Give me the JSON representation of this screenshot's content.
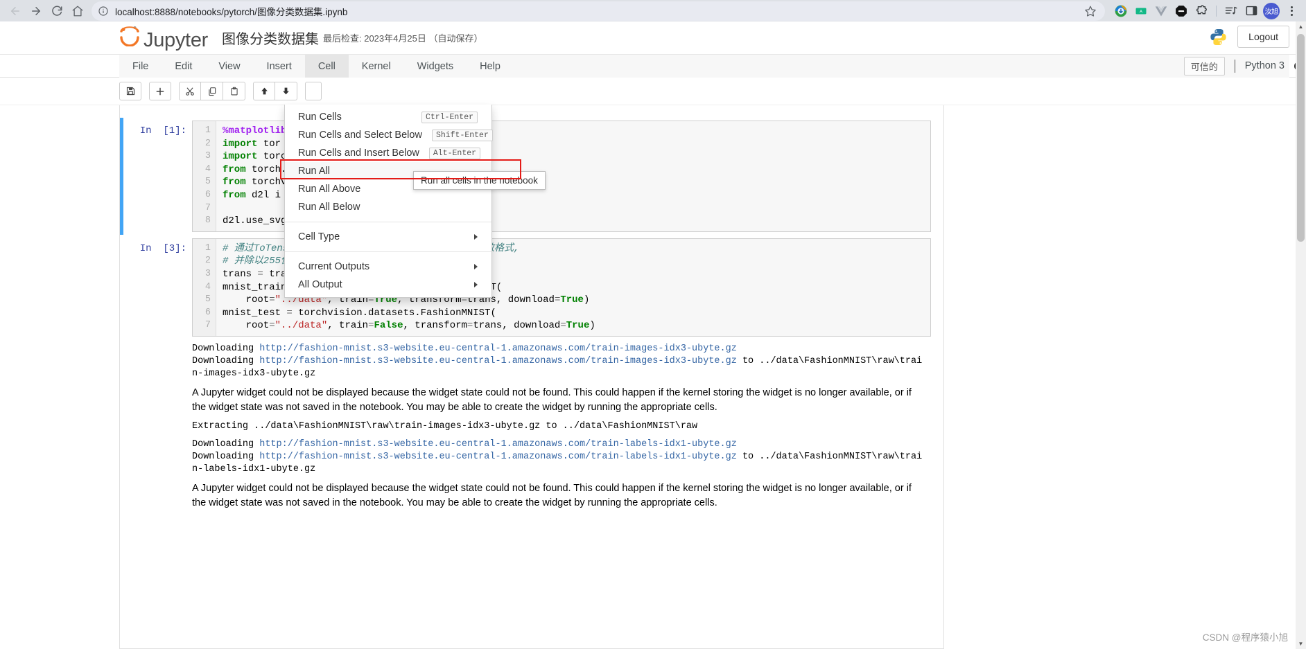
{
  "browser": {
    "url": "localhost:8888/notebooks/pytorch/图像分类数据集.ipynb",
    "nav": {
      "back": "back-arrow",
      "forward": "forward-arrow",
      "reload": "reload",
      "home": "home"
    },
    "info_icon": "info-circle-icon",
    "bookmark_icon": "star-icon",
    "extensions": [
      {
        "name": "idm-extension-icon",
        "glyph": "☁"
      },
      {
        "name": "translate-extension-icon",
        "glyph": "■"
      },
      {
        "name": "vue-devtools-icon",
        "glyph": "V"
      },
      {
        "name": "adblock-extension-icon",
        "glyph": "⊖"
      },
      {
        "name": "puzzle-extensions-icon",
        "glyph": "⬟"
      }
    ],
    "media_icon": "media-controls-icon",
    "sidepanel_icon": "side-panel-icon",
    "profile_initials": "汝旭",
    "menu_icon": "three-dot-menu-icon"
  },
  "jupyter": {
    "logo_text": "Jupyter",
    "notebook_title": "图像分类数据集",
    "checkpoint": "最后检查: 2023年4月25日 （自动保存）",
    "logout_label": "Logout",
    "python_logo": "python-logo",
    "menubar": [
      {
        "label": "File",
        "name": "menu-file",
        "active": false
      },
      {
        "label": "Edit",
        "name": "menu-edit",
        "active": false
      },
      {
        "label": "View",
        "name": "menu-view",
        "active": false
      },
      {
        "label": "Insert",
        "name": "menu-insert",
        "active": false
      },
      {
        "label": "Cell",
        "name": "menu-cell",
        "active": true
      },
      {
        "label": "Kernel",
        "name": "menu-kernel",
        "active": false
      },
      {
        "label": "Widgets",
        "name": "menu-widgets",
        "active": false
      },
      {
        "label": "Help",
        "name": "menu-help",
        "active": false
      }
    ],
    "trusted_badge": "可信的",
    "kernel_name": "Python 3",
    "kernel_status": "idle-circle"
  },
  "cell_menu": {
    "items": [
      {
        "label": "Run Cells",
        "shortcut": "Ctrl-Enter",
        "name": "menu-run-cells",
        "submenu": false,
        "highlight": false
      },
      {
        "label": "Run Cells and Select Below",
        "shortcut": "Shift-Enter",
        "name": "menu-run-cells-select-below",
        "submenu": false,
        "highlight": false
      },
      {
        "label": "Run Cells and Insert Below",
        "shortcut": "Alt-Enter",
        "name": "menu-run-cells-insert-below",
        "submenu": false,
        "highlight": false
      },
      {
        "label": "Run All",
        "shortcut": "",
        "name": "menu-run-all",
        "submenu": false,
        "highlight": true
      },
      {
        "label": "Run All Above",
        "shortcut": "",
        "name": "menu-run-all-above",
        "submenu": false,
        "highlight": false
      },
      {
        "label": "Run All Below",
        "shortcut": "",
        "name": "menu-run-all-below",
        "submenu": false,
        "highlight": false
      },
      {
        "separator": true
      },
      {
        "label": "Cell Type",
        "shortcut": "",
        "name": "menu-cell-type",
        "submenu": true,
        "highlight": false
      },
      {
        "separator": true
      },
      {
        "label": "Current Outputs",
        "shortcut": "",
        "name": "menu-current-outputs",
        "submenu": true,
        "highlight": false
      },
      {
        "label": "All Output",
        "shortcut": "",
        "name": "menu-all-output",
        "submenu": true,
        "highlight": false
      }
    ],
    "tooltip": "Run all cells in the notebook",
    "highlight_color": "#e41b17"
  },
  "toolbar": {
    "buttons": [
      {
        "name": "save-button",
        "glyph": "save"
      },
      {
        "name": "insert-cell-below-button",
        "glyph": "plus"
      },
      {
        "name": "cut-cell-button",
        "glyph": "scissors"
      },
      {
        "name": "copy-cell-button",
        "glyph": "copy"
      },
      {
        "name": "paste-cell-button",
        "glyph": "paste"
      },
      {
        "name": "move-cell-up-button",
        "glyph": "arrow-up"
      },
      {
        "name": "move-cell-down-button",
        "glyph": "arrow-down"
      }
    ]
  },
  "notebook": {
    "cells": [
      {
        "prompt": "In  [1]:",
        "name": "code-cell-1",
        "selected": true,
        "lines": [
          "1",
          "2",
          "3",
          "4",
          "5",
          "6",
          "7",
          "8"
        ],
        "code_html": "<span class='k-magic'>%matplotlib</span> inline\n<span class='k-kw'>import</span> tor\n<span class='k-kw'>import</span> torc\n<span class='k-kw'>from</span> torch.\n<span class='k-kw'>from</span> torchv\n<span class='k-kw'>from</span> d2l i\n\nd2l.use_svg"
      },
      {
        "prompt": "In  [3]:",
        "name": "code-cell-2",
        "selected": false,
        "lines": [
          "1",
          "2",
          "3",
          "4",
          "5",
          "6",
          "7"
        ],
        "code_html": "<span class='k-com'># 通过ToTensor实例将图像数据从PIL类型变换成32位浮点数格式,</span>\n<span class='k-com'># 并除以255使得所有像素的数值均在0～1之间</span>\ntrans <span class='k-op'>=</span> transforms.ToTensor()\nmnist_train <span class='k-op'>=</span> torchvision.datasets.FashionMNIST(\n    root<span class='k-op'>=</span><span class='k-str'>\"../data\"</span>, train<span class='k-op'>=</span><span class='k-kw'>True</span>, transform<span class='k-op'>=</span>trans, download<span class='k-op'>=</span><span class='k-kw'>True</span>)\nmnist_test <span class='k-op'>=</span> torchvision.datasets.FashionMNIST(\n    root<span class='k-op'>=</span><span class='k-str'>\"../data\"</span>, train<span class='k-op'>=</span><span class='k-kw'>False</span>, transform<span class='k-op'>=</span>trans, download<span class='k-op'>=</span><span class='k-kw'>True</span>)"
      }
    ],
    "outputs": [
      {
        "name": "output-download-train-images",
        "type": "mono",
        "html": "Downloading <span class='out-link'>http://fashion-mnist.s3-website.eu-central-1.amazonaws.com/train-images-idx3-ubyte.gz</span>\nDownloading <span class='out-link'>http://fashion-mnist.s3-website.eu-central-1.amazonaws.com/train-images-idx3-ubyte.gz</span> to ../data\\FashionMNIST\\raw\\train-images-idx3-ubyte.gz"
      },
      {
        "name": "output-widget-warning-1",
        "type": "warn",
        "html": "A Jupyter widget could not be displayed because the widget state could not be found. This could happen if the kernel storing the widget is no longer available, or if the widget state was not saved in the notebook. You may be able to create the widget by running the appropriate cells."
      },
      {
        "name": "output-extracting-train-images",
        "type": "mono",
        "html": "Extracting ../data\\FashionMNIST\\raw\\train-images-idx3-ubyte.gz to ../data\\FashionMNIST\\raw"
      },
      {
        "name": "output-download-train-labels",
        "type": "mono",
        "html": "Downloading <span class='out-link'>http://fashion-mnist.s3-website.eu-central-1.amazonaws.com/train-labels-idx1-ubyte.gz</span>\nDownloading <span class='out-link'>http://fashion-mnist.s3-website.eu-central-1.amazonaws.com/train-labels-idx1-ubyte.gz</span> to ../data\\FashionMNIST\\raw\\train-labels-idx1-ubyte.gz"
      },
      {
        "name": "output-widget-warning-2",
        "type": "warn",
        "html": "A Jupyter widget could not be displayed because the widget state could not be found. This could happen if the kernel storing the widget is no longer available, or if the widget state was not saved in the notebook. You may be able to create the widget by running the appropriate cells."
      }
    ]
  },
  "watermark": "CSDN @程序猿小旭"
}
